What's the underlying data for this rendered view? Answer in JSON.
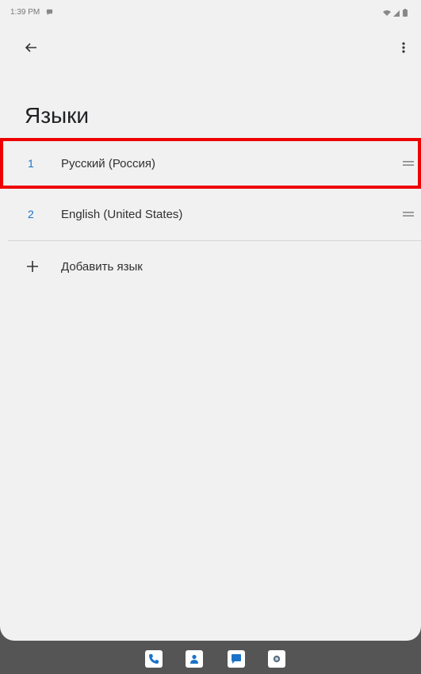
{
  "status_bar": {
    "time": "1:39 PM",
    "notification_icon": "chat-bubble-icon",
    "right_icons": [
      "wifi-icon",
      "signal-icon",
      "battery-icon"
    ]
  },
  "app_bar": {
    "back_icon": "arrow-back-icon",
    "more_icon": "more-vert-icon"
  },
  "page": {
    "title": "Языки"
  },
  "languages": [
    {
      "index": "1",
      "name": "Русский (Россия)",
      "highlighted": true
    },
    {
      "index": "2",
      "name": "English (United States)",
      "highlighted": false
    }
  ],
  "add_language": {
    "icon": "plus-icon",
    "label": "Добавить язык"
  },
  "dock": {
    "apps": [
      "phone-icon",
      "contacts-icon",
      "messages-icon",
      "camera-icon"
    ]
  },
  "colors": {
    "accent": "#1a73c8",
    "highlight_border": "#ee0000",
    "background": "#f1f1f1",
    "dock": "#555555"
  }
}
